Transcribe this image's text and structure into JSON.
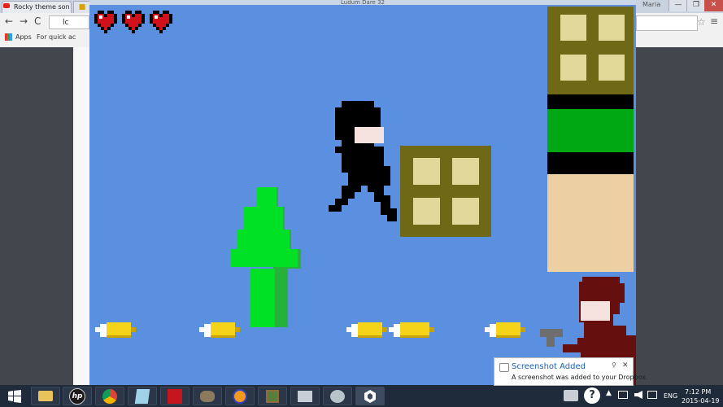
{
  "browser": {
    "tabs": [
      {
        "label": "Rocky theme son"
      }
    ],
    "user_label": "Maria",
    "omnibox_text": "lc",
    "bookmarks": {
      "apps_label": "Apps",
      "quick_label": "For quick ac"
    },
    "controls": {
      "minimize": "—",
      "maximize": "❐",
      "close": "✕",
      "back": "←",
      "forward": "→",
      "reload": "C",
      "star": "☆",
      "menu": "≡"
    }
  },
  "game": {
    "window_title": "Ludum Dare 32",
    "lives": 3,
    "colors": {
      "sky": "#5b8fe0",
      "heart": "#d0101a",
      "tree": "#00e025",
      "tree_shadow": "#26b23a",
      "box": "#6f6816",
      "box_window": "#e2d89a",
      "ninja": "#000000",
      "face": "#f5e2de",
      "enemy": "#650f0f",
      "banana": "#f5d318",
      "building_green": "#00a814",
      "building_tan": "#edcfa4"
    }
  },
  "toast": {
    "title": "Screenshot Added",
    "body": "A screenshot was added to your Dropbox.",
    "close": "✕",
    "pin": "⚲"
  },
  "taskbar": {
    "language": "ENG",
    "time": "7:12 PM",
    "date": "2015-04-19",
    "apps": [
      "start-icon",
      "file-explorer-icon",
      "hp-icon",
      "chrome-icon",
      "notepad-icon",
      "adobe-icon",
      "gimp-icon",
      "audacity-icon",
      "minecraft-icon",
      "scanner-icon",
      "photo-icon",
      "unity-icon"
    ]
  }
}
